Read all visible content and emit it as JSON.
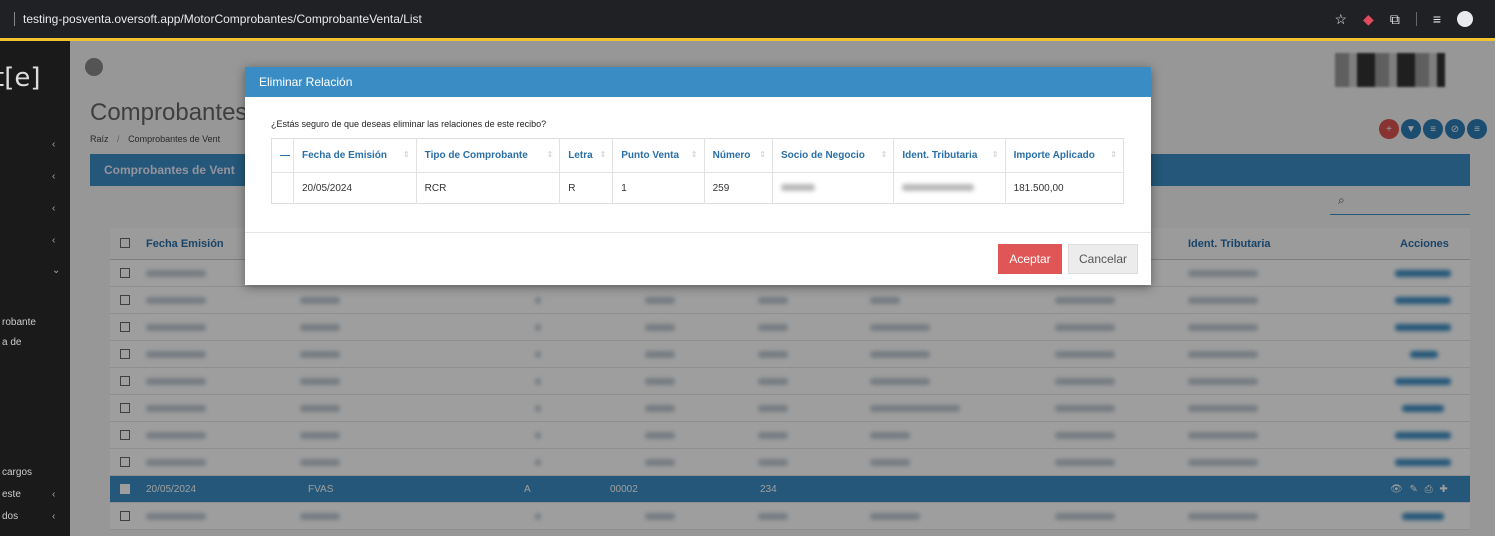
{
  "browser": {
    "url": "testing-posventa.oversoft.app/MotorComprobantes/ComprobanteVenta/List",
    "star_icon": "☆",
    "ext_icon": "◆",
    "puzzle_icon": "⧉",
    "media_icon": "≡",
    "profile_icon": "profile"
  },
  "sidebar": {
    "logo": "t[e]",
    "items": [
      {
        "label": ""
      },
      {
        "label": ""
      },
      {
        "label": ""
      },
      {
        "label": ""
      },
      {
        "label": ""
      }
    ],
    "texts": [
      "robante",
      "a de",
      "cargos",
      "este",
      "dos"
    ]
  },
  "page": {
    "title": "Comprobantes de",
    "breadcrumb_root": "Raíz",
    "breadcrumb_sep": "/",
    "breadcrumb_current": "Comprobantes de Vent",
    "section_title": "Comprobantes de Vent",
    "search_icon": "⌕",
    "grid_headers": {
      "fecha": "Fecha Emisión",
      "ident": "Ident. Tributaria",
      "acciones": "Acciones"
    },
    "selected_row": {
      "fecha": "20/05/2024",
      "tipo": "FVAS",
      "letra": "A",
      "punto": "00002",
      "numero": "234",
      "acciones": "👁 ✎ ⎙ ✚"
    }
  },
  "modal": {
    "title": "Eliminar Relación",
    "question": "¿Estás seguro de que deseas eliminar las relaciones de este recibo?",
    "columns": [
      "—",
      "Fecha de Emisión",
      "Tipo de Comprobante",
      "Letra",
      "Punto Venta",
      "Número",
      "Socio de Negocio",
      "Ident. Tributaria",
      "Importe Aplicado"
    ],
    "row": {
      "fecha": "20/05/2024",
      "tipo": "RCR",
      "letra": "R",
      "punto": "1",
      "numero": "259",
      "importe": "181.500,00"
    },
    "accept": "Aceptar",
    "cancel": "Cancelar"
  },
  "colors": {
    "primary": "#3a8dc4",
    "danger": "#e05555",
    "browser_accent": "#f2c230"
  }
}
